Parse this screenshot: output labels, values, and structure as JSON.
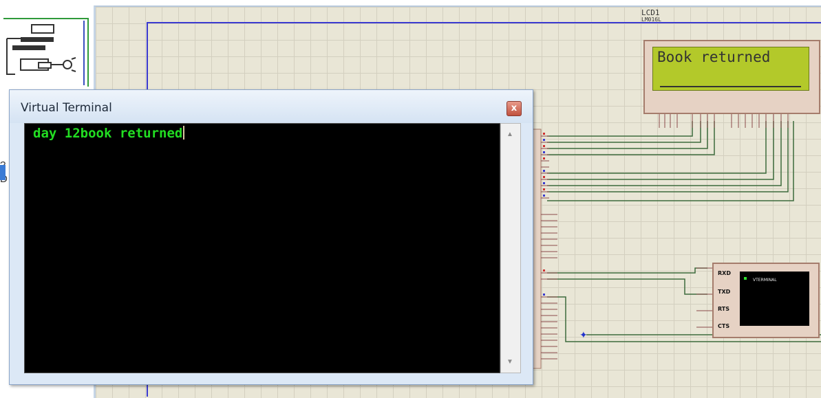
{
  "vt_window": {
    "title": "Virtual Terminal",
    "close_glyph": "x",
    "output": "day 12book returned",
    "scroll_up": "▲",
    "scroll_down": "▼"
  },
  "lcd": {
    "ref_label": "LCD1",
    "part_label": "LM016L",
    "display_text": "Book returned"
  },
  "terminal_component": {
    "label": "VTERMINAL",
    "pins": [
      "RXD",
      "TXD",
      "RTS",
      "CTS"
    ]
  },
  "left_panel": {
    "mark_1": "?",
    "mark_2": "D"
  },
  "colors": {
    "canvas": "#e9e6d6",
    "wire": "#3c6a3c",
    "bus": "#3a3ad0",
    "terminal_text": "#22dd22"
  },
  "icons": [
    "close-icon",
    "scroll-up-icon",
    "scroll-down-icon",
    "junction-icon"
  ]
}
